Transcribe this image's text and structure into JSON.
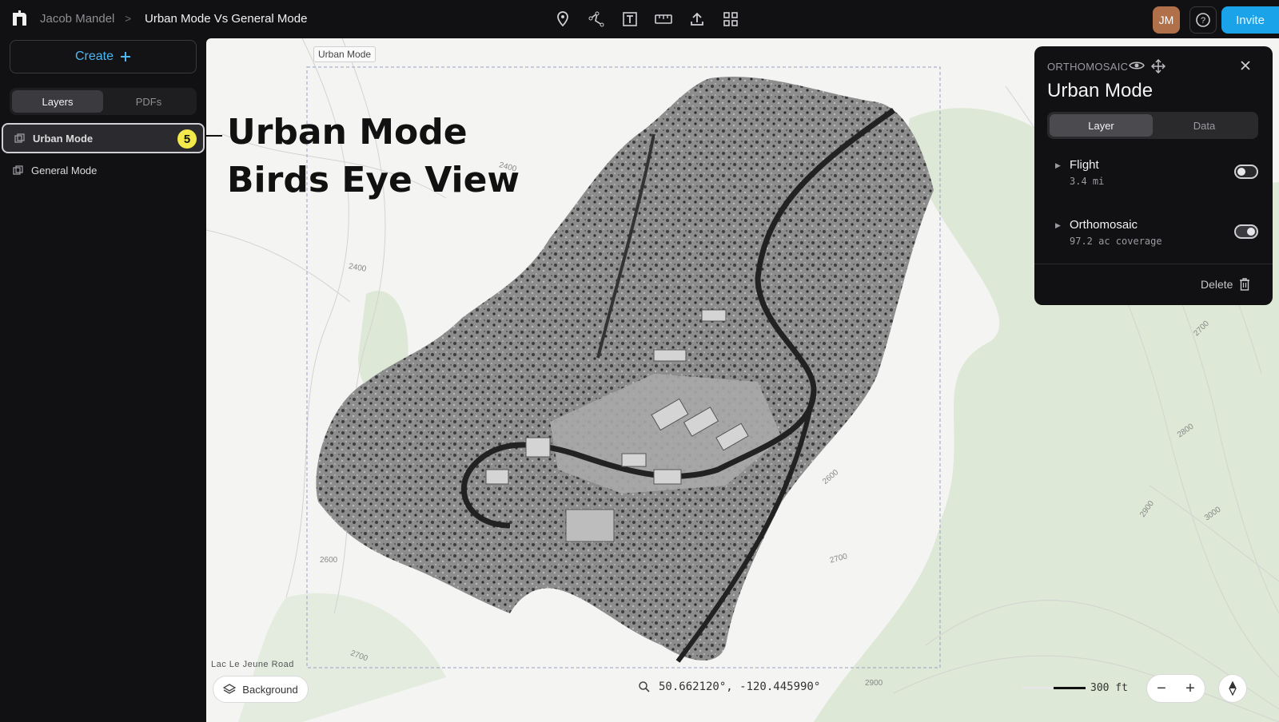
{
  "header": {
    "user_name": "Jacob Mandel",
    "separator": ">",
    "project_title": "Urban Mode Vs General Mode",
    "tools": [
      "location-pin-icon",
      "polyline-icon",
      "text-box-icon",
      "ruler-icon",
      "upload-icon",
      "grid-icon"
    ],
    "avatar_initials": "JM",
    "invite_label": "Invite"
  },
  "sidebar": {
    "create_label": "Create",
    "tabs": [
      {
        "label": "Layers",
        "active": true
      },
      {
        "label": "PDFs",
        "active": false
      }
    ],
    "layers": [
      {
        "label": "Urban Mode",
        "selected": true,
        "badge": "5"
      },
      {
        "label": "General Mode",
        "selected": false
      }
    ]
  },
  "map": {
    "frame_label": "Urban Mode",
    "annotation_line1": "Urban Mode",
    "annotation_line2": "Birds Eye View",
    "road_label": "Lac Le Jeune Road",
    "background_label": "Background",
    "coordinates": "50.662120°, -120.445990°",
    "scale_label": "300 ft",
    "zoom_out": "−",
    "zoom_in": "+",
    "contour_labels": [
      "2400",
      "2400",
      "2600",
      "2600",
      "2700",
      "2700",
      "2800",
      "2900",
      "3000",
      "2900",
      "2700"
    ]
  },
  "panel": {
    "kicker": "ORTHOMOSAIC",
    "title": "Urban Mode",
    "tabs": [
      {
        "label": "Layer",
        "active": true
      },
      {
        "label": "Data",
        "active": false
      }
    ],
    "rows": [
      {
        "name": "Flight",
        "sub": "3.4 mi",
        "enabled": false
      },
      {
        "name": "Orthomosaic",
        "sub": "97.2 ac coverage",
        "enabled": true
      }
    ],
    "delete_label": "Delete"
  },
  "colors": {
    "accent": "#1aa3e8",
    "badge": "#f3e94a",
    "avatar": "#b0704a",
    "map_background": "#f4f4f2",
    "vegetation": "#dde8d6"
  }
}
